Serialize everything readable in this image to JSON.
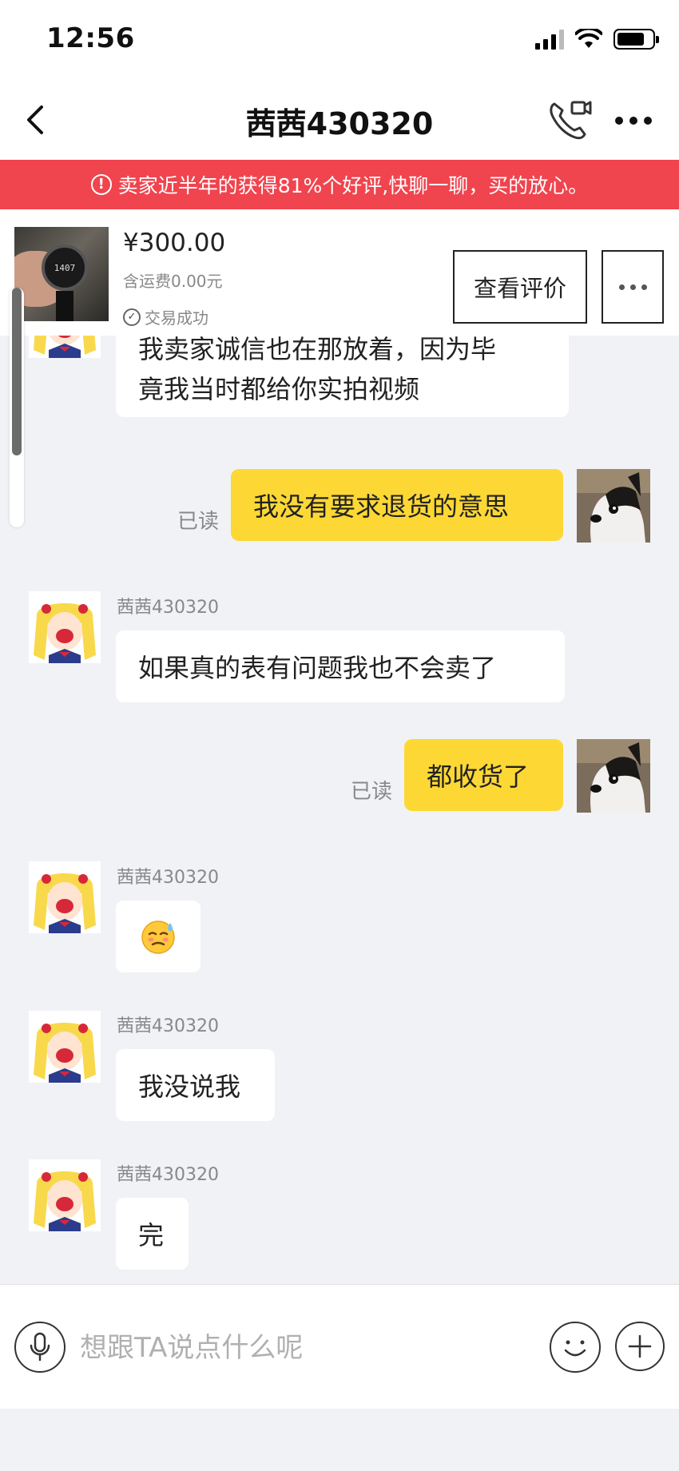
{
  "status_bar": {
    "time": "12:56"
  },
  "header": {
    "title": "茜茜430320"
  },
  "notice": {
    "text": "卖家近半年的获得81%个好评,快聊一聊，买的放心。"
  },
  "product": {
    "price": "¥300.00",
    "shipping": "含运费0.00元",
    "status": "交易成功",
    "review_label": "查看评价",
    "thumb_watch_text": "1407"
  },
  "messages": [
    {
      "side": "in",
      "sender": "",
      "text_lines": [
        "我卖家诚信也在那放着，因为毕",
        "竟我当时都给你实拍视频"
      ]
    },
    {
      "side": "out",
      "text": "我没有要求退货的意思",
      "read": "已读"
    },
    {
      "side": "in",
      "sender": "茜茜430320",
      "text": "如果真的表有问题我也不会卖了"
    },
    {
      "side": "out",
      "text": "都收货了",
      "read": "已读"
    },
    {
      "side": "in",
      "sender": "茜茜430320",
      "text": "😓"
    },
    {
      "side": "in",
      "sender": "茜茜430320",
      "text": "我没说我"
    },
    {
      "side": "in",
      "sender": "茜茜430320",
      "text": "完"
    }
  ],
  "input": {
    "placeholder": "想跟TA说点什么呢"
  },
  "colors": {
    "notice_bg": "#f0444e",
    "out_bubble": "#fdd835",
    "background": "#f1f2f6"
  }
}
